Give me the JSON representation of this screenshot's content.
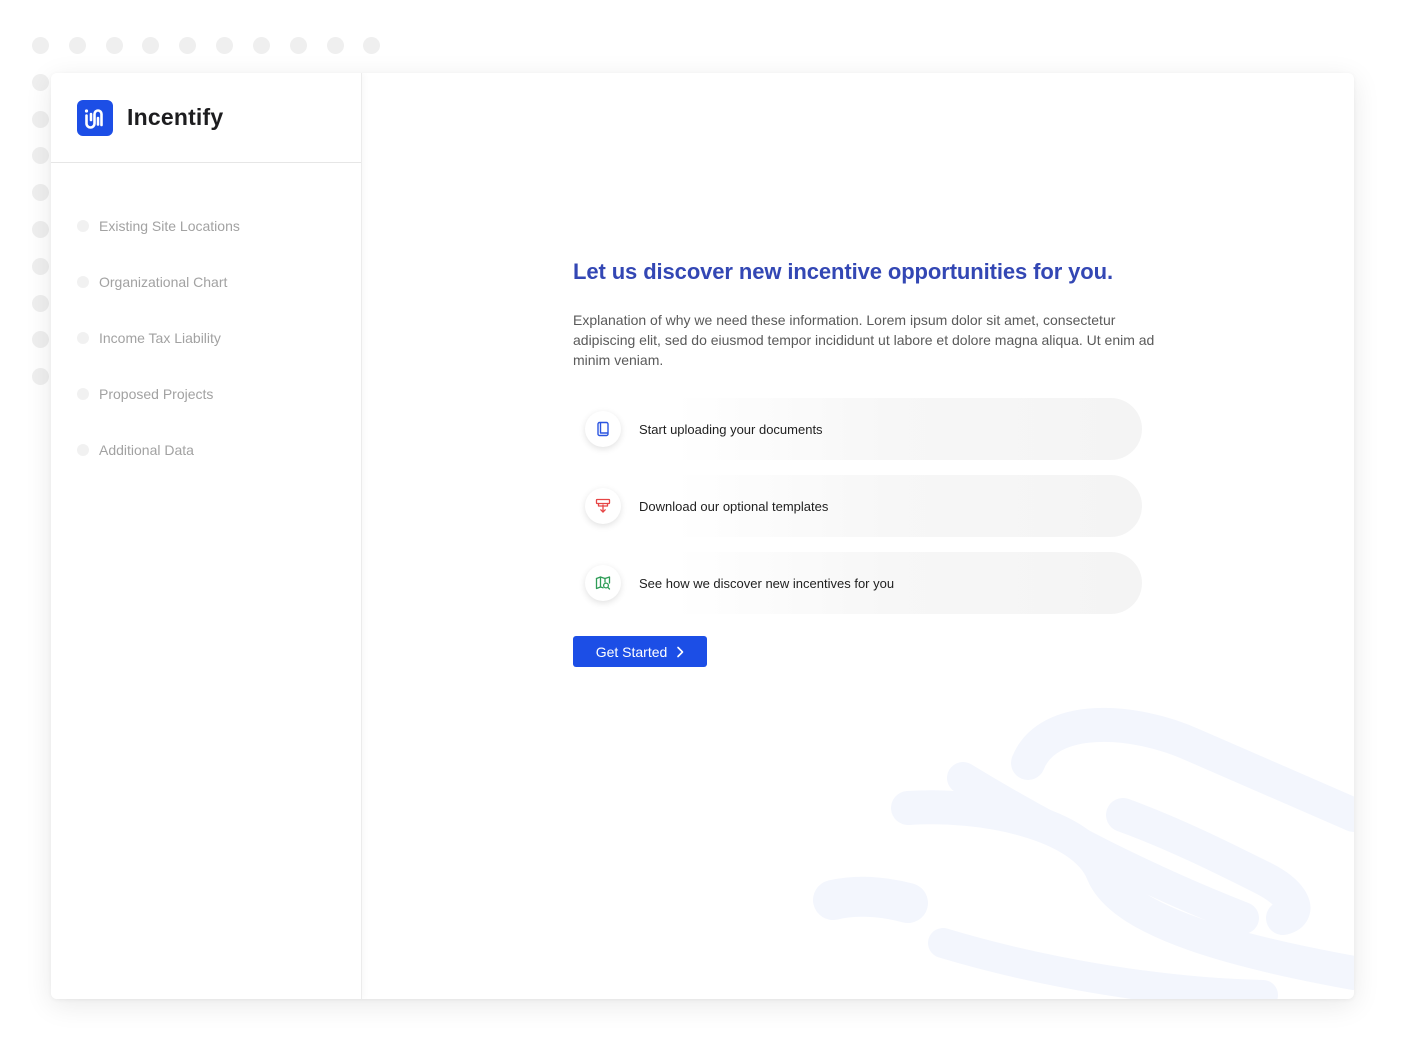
{
  "app": {
    "name": "Incentify",
    "brand_color": "#1c4ee6",
    "accent_color": "#3347b4"
  },
  "sidebar": {
    "items": [
      {
        "label": "Existing Site Locations"
      },
      {
        "label": "Organizational Chart"
      },
      {
        "label": "Income Tax Liability"
      },
      {
        "label": "Proposed Projects"
      },
      {
        "label": "Additional Data"
      }
    ]
  },
  "main": {
    "headline": "Let us discover new incentive opportunities for you.",
    "description": "Explanation of why we need these information. Lorem ipsum dolor sit amet, consectetur adipiscing elit, sed do eiusmod tempor incididunt ut labore et dolore magna aliqua. Ut enim ad minim veniam.",
    "options": [
      {
        "label": "Start uploading your documents",
        "icon": "document-icon",
        "color": "#2b55e0"
      },
      {
        "label": "Download our optional templates",
        "icon": "download-icon",
        "color": "#e64545"
      },
      {
        "label": "See how we discover new incentives for you",
        "icon": "map-search-icon",
        "color": "#2f9d57"
      }
    ],
    "cta_label": "Get Started"
  }
}
